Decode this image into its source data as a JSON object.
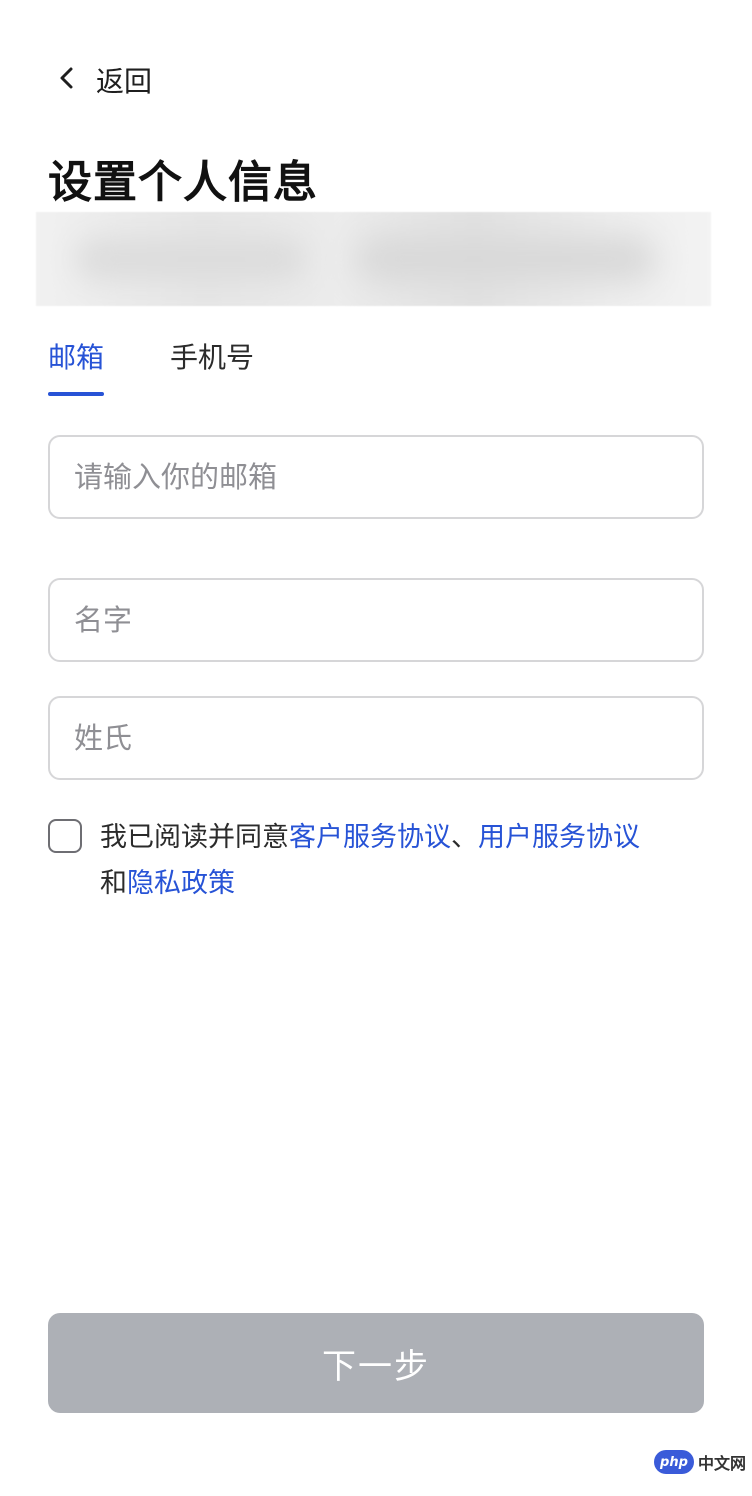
{
  "header": {
    "back_label": "返回",
    "title": "设置个人信息"
  },
  "tabs": [
    {
      "label": "邮箱",
      "active": true
    },
    {
      "label": "手机号",
      "active": false
    }
  ],
  "form": {
    "email_placeholder": "请输入你的邮箱",
    "first_name_placeholder": "名字",
    "last_name_placeholder": "姓氏"
  },
  "agreement": {
    "checked": false,
    "prefix": "我已阅读并同意",
    "link1": "客户服务协议",
    "sep": "、",
    "link2": "用户服务协议",
    "and": "和",
    "link3": "隐私政策"
  },
  "next_button": {
    "label": "下一步",
    "disabled": true
  },
  "watermark": {
    "badge": "php",
    "text": "中文网"
  },
  "colors": {
    "accent": "#2753d6",
    "button_disabled": "#adb0b6",
    "border": "#d6d6d8"
  }
}
